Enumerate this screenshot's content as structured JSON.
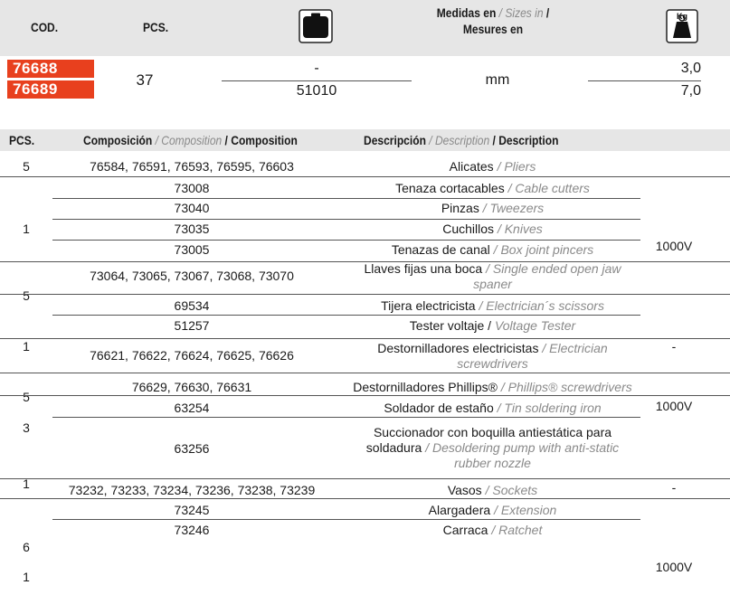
{
  "top": {
    "cod_label": "COD.",
    "pcs_label": "PCS.",
    "case_icon": "case-icon",
    "sizes_label_es": "Medidas en",
    "sizes_label_en": "/ Sizes in",
    "sizes_label_sep": "/",
    "sizes_label_fr": "Mesures en",
    "weight_icon": "weight-kg-icon",
    "weight_icon_text": "Kg",
    "codes": [
      "76688",
      "76689"
    ],
    "pcs": "37",
    "dims": [
      "-",
      "51010"
    ],
    "unit": "mm",
    "weights": [
      "3,0",
      "7,0"
    ]
  },
  "table": {
    "headers": {
      "pcs": "PCS.",
      "comp_es": "Composición",
      "comp_en": "/ Composition",
      "comp_fr": "/ Composition",
      "desc_es": "Descripción",
      "desc_en": "/ Description",
      "desc_fr": "/ Description"
    },
    "rows": [
      {
        "comp": "76584, 76591, 76593, 76595, 76603",
        "desc_es": "Alicates",
        "desc_en": "/ Pliers"
      },
      {
        "comp": "73008",
        "desc_es": "Tenaza cortacables",
        "desc_en": "/ Cable cutters"
      },
      {
        "comp": "73040",
        "desc_es": "Pinzas",
        "desc_en": "/ Tweezers"
      },
      {
        "comp": "73035",
        "desc_es": "Cuchillos",
        "desc_en": "/ Knives"
      },
      {
        "comp": "73005",
        "desc_es": "Tenazas de canal",
        "desc_en": "/ Box joint pincers"
      },
      {
        "comp": "73064, 73065, 73067, 73068, 73070",
        "desc_es": "Llaves fijas una boca",
        "desc_en": "/ Single ended open jaw",
        "desc_en2": "spaner"
      },
      {
        "comp": "69534",
        "desc_es": "Tijera electricista",
        "desc_en": "/ Electrician´s scissors"
      },
      {
        "comp": "51257",
        "desc_es": "Tester voltaje /",
        "desc_en": "Voltage Tester"
      },
      {
        "comp": "76621, 76622, 76624, 76625, 76626",
        "desc_es": "Destornilladores electricistas",
        "desc_en": "/ Electrician",
        "desc_en2": "screwdrivers"
      },
      {
        "comp": "76629, 76630, 76631",
        "desc_es": "Destornilladores Phillips®",
        "desc_en": "/ Phillips® screwdrivers"
      },
      {
        "comp": "63254",
        "desc_es": "Soldador de estaño",
        "desc_en": "/ Tin soldering iron"
      },
      {
        "comp": "63256",
        "desc_es": "Succionador con boquilla antiestática para",
        "desc_es2": "soldadura",
        "desc_en": "/ Desoldering pump with anti-static",
        "desc_en2": "rubber nozzle"
      },
      {
        "comp": "73232, 73233, 73234, 73236, 73238, 73239",
        "desc_es": "Vasos",
        "desc_en": "/ Sockets"
      },
      {
        "comp": "73245",
        "desc_es": "Alargadera",
        "desc_en": "/ Extension"
      },
      {
        "comp": "73246",
        "desc_es": "Carraca",
        "desc_en": "/ Ratchet"
      }
    ],
    "pcs_groups": [
      "5",
      "1",
      "5",
      "1",
      "5",
      "3",
      "1",
      "6",
      "1"
    ],
    "voltage_groups": [
      "1000V",
      "-",
      "1000V",
      "-",
      "1000V"
    ]
  }
}
